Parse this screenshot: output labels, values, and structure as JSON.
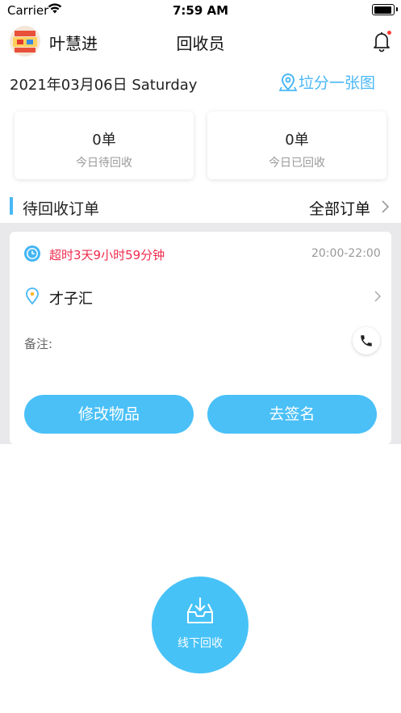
{
  "status_bar": {
    "carrier": "Carrier",
    "time": "7:59 AM"
  },
  "header": {
    "user_name": "叶慧进",
    "title": "回收员"
  },
  "date_line": {
    "date": "2021年03月06日 Saturday",
    "map_link": "垃分一张图"
  },
  "stats": [
    {
      "value": "0单",
      "label": "今日待回收"
    },
    {
      "value": "0单",
      "label": "今日已回收"
    }
  ],
  "section": {
    "title": "待回收订单",
    "all_orders": "全部订单"
  },
  "order": {
    "overtime": "超时3天9小时59分钟",
    "time_slot": "20:00-22:00",
    "address": "才子汇",
    "note_label": "备注:",
    "edit_button": "修改物品",
    "sign_button": "去签名"
  },
  "fab": {
    "label": "线下回收"
  },
  "colors": {
    "accent": "#4ab8f5",
    "alert": "#ef2b4d",
    "background_gray": "#e9e9ec"
  }
}
